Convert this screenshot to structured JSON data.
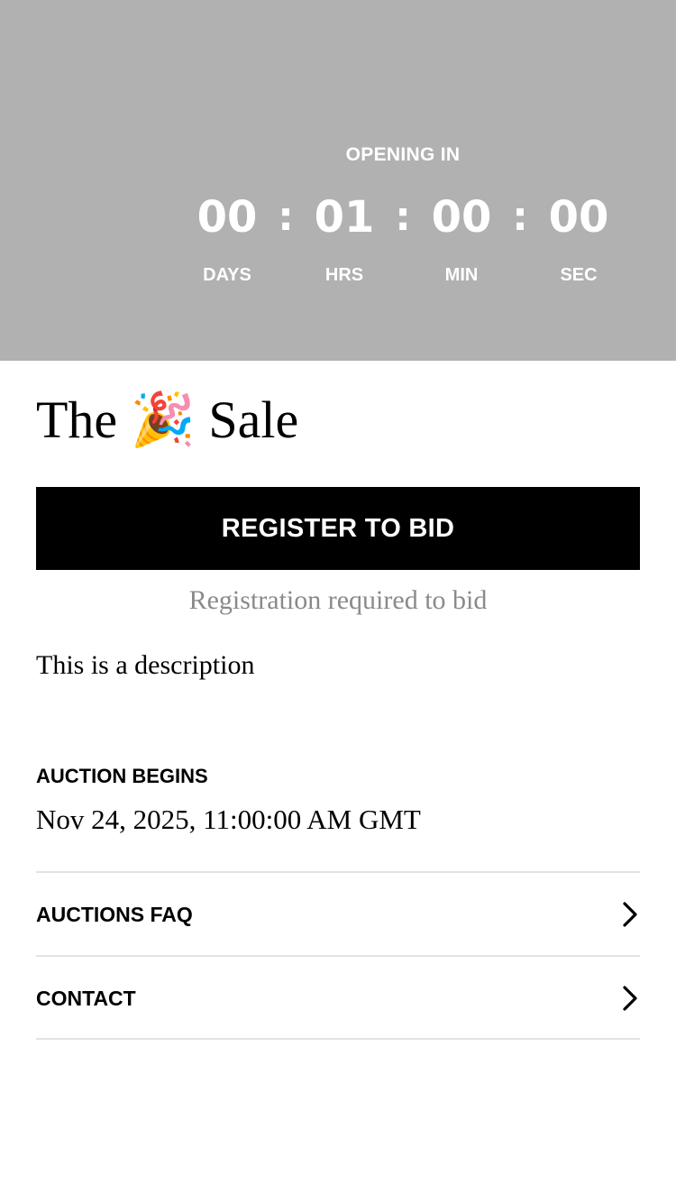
{
  "countdown": {
    "heading": "OPENING IN",
    "separator": ":",
    "units": [
      {
        "value": "00",
        "label": "DAYS"
      },
      {
        "value": "01",
        "label": "HRS"
      },
      {
        "value": "00",
        "label": "MIN"
      },
      {
        "value": "00",
        "label": "SEC"
      }
    ]
  },
  "sale": {
    "title_prefix": "The",
    "title_emoji": "🎉",
    "title_suffix": "Sale",
    "register_label": "REGISTER TO BID",
    "registration_note": "Registration required to bid",
    "description": "This is a description"
  },
  "auction": {
    "begins_label": "AUCTION BEGINS",
    "begins_value": "Nov 24, 2025, 11:00:00 AM GMT"
  },
  "links": [
    {
      "label": "AUCTIONS FAQ",
      "icon": "chevron-right-icon"
    },
    {
      "label": "CONTACT",
      "icon": "chevron-right-icon"
    }
  ],
  "colors": {
    "hero_bg": "#b1b1b1",
    "button_bg": "#000000",
    "muted_text": "#8a8a8a",
    "divider": "#e3e3e3"
  }
}
